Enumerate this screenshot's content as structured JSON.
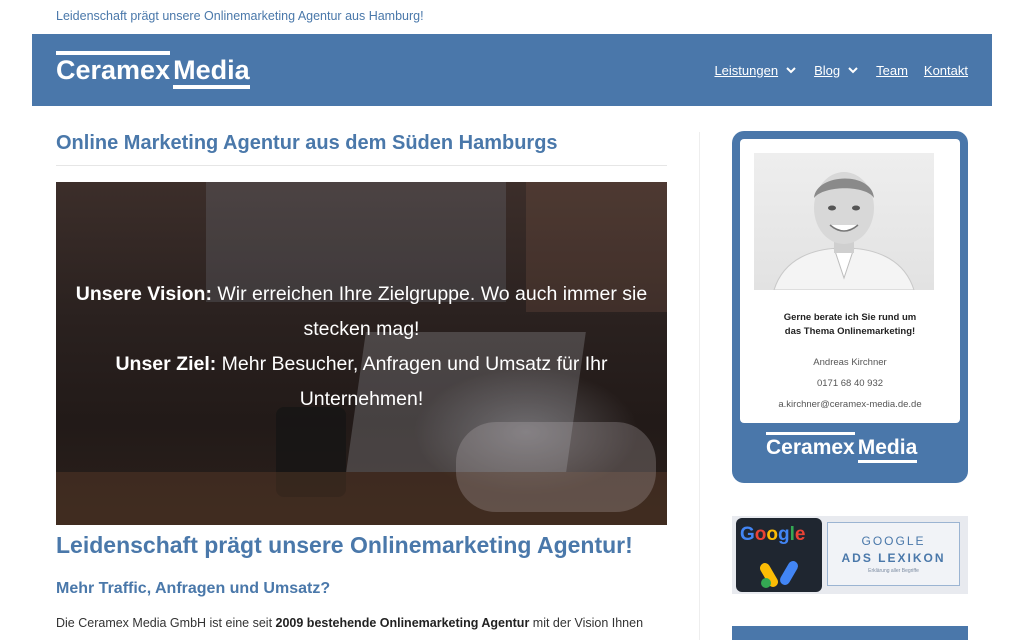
{
  "top_tagline": "Leidenschaft prägt unsere Onlinemarketing Agentur aus Hamburg!",
  "header": {
    "logo_word1": "Ceramex",
    "logo_word2": "Media",
    "nav": [
      {
        "label": "Leistungen",
        "has_dropdown": true
      },
      {
        "label": "Blog",
        "has_dropdown": true
      },
      {
        "label": "Team",
        "has_dropdown": false
      },
      {
        "label": "Kontakt",
        "has_dropdown": false
      }
    ]
  },
  "main": {
    "title": "Online Marketing Agentur aus dem Süden Hamburgs",
    "hero": {
      "vision_label": "Unsere Vision:",
      "vision_text": " Wir erreichen Ihre Zielgruppe. Wo auch immer sie stecken mag!",
      "goal_label": "Unser Ziel:",
      "goal_text": " Mehr Besucher, Anfragen und Umsatz für Ihr Unternehmen!"
    },
    "heading": "Leidenschaft prägt unsere Onlinemarketing Agentur!",
    "subheading": "Mehr Traffic, Anfragen und Umsatz?",
    "paragraph_start": "Die Ceramex Media GmbH ist eine seit ",
    "paragraph_bold": "2009 bestehende Onlinemarketing Agentur",
    "paragraph_end": " mit der Vision Ihnen"
  },
  "sidebar": {
    "contact_card": {
      "headline_line1": "Gerne berate ich Sie rund um",
      "headline_line2": "das Thema Onlinemarketing!",
      "name": "Andreas Kirchner",
      "phone": "0171 68 40 932",
      "email": "a.kirchner@ceramex-media.de.de",
      "logo_word1": "Ceramex",
      "logo_word2": "Media"
    },
    "ads_banner": {
      "google_word": "Google",
      "title_line1": "GOOGLE",
      "title_line2": "ADS LEXIKON",
      "small_text": "Erklärung aller Begriffe"
    }
  },
  "colors": {
    "brand_blue": "#4a77aa",
    "heading_blue": "#4a78aa",
    "header_text": "#ffffff"
  }
}
